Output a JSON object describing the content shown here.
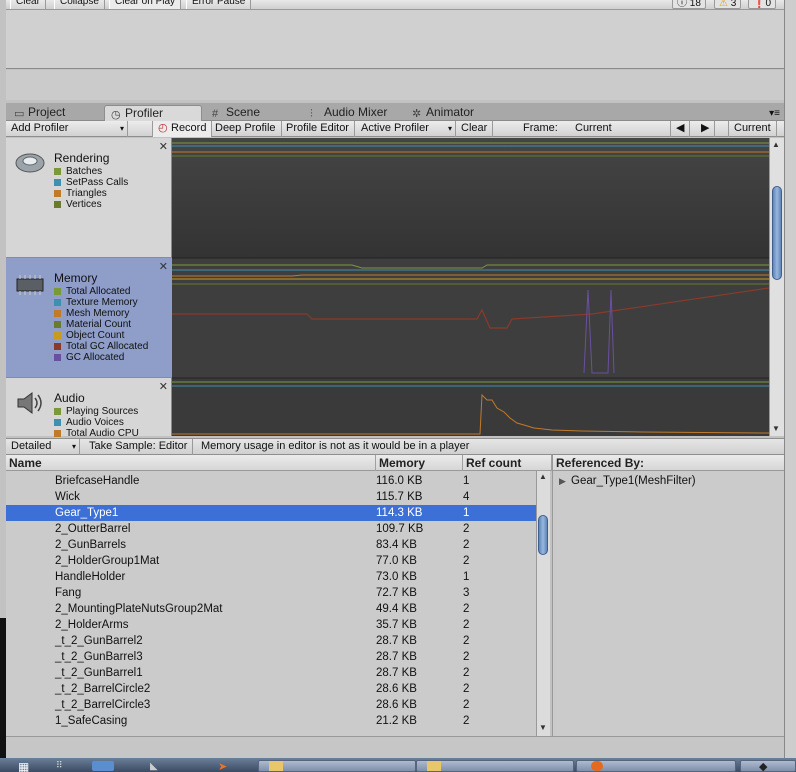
{
  "console": {
    "buttons": [
      "Clear",
      "Collapse",
      "Clear on Play",
      "Error Pause"
    ],
    "counts": {
      "info": "18",
      "warnings": "3",
      "errors": "0"
    }
  },
  "tabs": [
    {
      "label": "Project",
      "icon": "folder-icon"
    },
    {
      "label": "Profiler",
      "icon": "profiler-icon"
    },
    {
      "label": "Scene",
      "icon": "grid-icon"
    },
    {
      "label": "Audio Mixer",
      "icon": "mixer-icon"
    },
    {
      "label": "Animator",
      "icon": "animator-icon"
    }
  ],
  "toolbar": {
    "add_profiler": "Add Profiler",
    "record": "Record",
    "deep_profile": "Deep Profile",
    "profile_editor": "Profile Editor",
    "active_profiler": "Active Profiler",
    "clear": "Clear",
    "frame_label": "Frame:",
    "frame_value": "Current",
    "current_btn": "Current"
  },
  "modules": [
    {
      "title": "Rendering",
      "legend": [
        {
          "label": "Batches",
          "color": "#7a9a3a"
        },
        {
          "label": "SetPass Calls",
          "color": "#3f8fb0"
        },
        {
          "label": "Triangles",
          "color": "#c07a2a"
        },
        {
          "label": "Vertices",
          "color": "#6a7a30"
        }
      ]
    },
    {
      "title": "Memory",
      "legend": [
        {
          "label": "Total Allocated",
          "color": "#7a9a3a"
        },
        {
          "label": "Texture Memory",
          "color": "#3f8fb0"
        },
        {
          "label": "Mesh Memory",
          "color": "#c07a2a"
        },
        {
          "label": "Material Count",
          "color": "#6a7a30"
        },
        {
          "label": "Object Count",
          "color": "#c99a20"
        },
        {
          "label": "Total GC Allocated",
          "color": "#8a3a2a"
        },
        {
          "label": "GC Allocated",
          "color": "#6a50a0"
        }
      ]
    },
    {
      "title": "Audio",
      "legend": [
        {
          "label": "Playing Sources",
          "color": "#7a9a3a"
        },
        {
          "label": "Audio Voices",
          "color": "#3f8fb0"
        },
        {
          "label": "Total Audio CPU",
          "color": "#c07a2a"
        }
      ]
    }
  ],
  "detail_toolbar": {
    "mode": "Detailed",
    "take_sample": "Take Sample: Editor",
    "note": "Memory usage in editor is not as it would be in a player"
  },
  "table": {
    "columns": [
      "Name",
      "Memory",
      "Ref count"
    ],
    "rows": [
      {
        "name": "BriefcaseHandle",
        "memory": "116.0 KB",
        "refs": "1"
      },
      {
        "name": "Wick",
        "memory": "115.7 KB",
        "refs": "4"
      },
      {
        "name": "Gear_Type1",
        "memory": "114.3 KB",
        "refs": "1"
      },
      {
        "name": "2_OutterBarrel",
        "memory": "109.7 KB",
        "refs": "2"
      },
      {
        "name": "2_GunBarrels",
        "memory": "83.4 KB",
        "refs": "2"
      },
      {
        "name": "2_HolderGroup1Mat",
        "memory": "77.0 KB",
        "refs": "2"
      },
      {
        "name": "HandleHolder",
        "memory": "73.0 KB",
        "refs": "1"
      },
      {
        "name": "Fang",
        "memory": "72.7 KB",
        "refs": "3"
      },
      {
        "name": "2_MountingPlateNutsGroup2Mat",
        "memory": "49.4 KB",
        "refs": "2"
      },
      {
        "name": "2_HolderArms",
        "memory": "35.7 KB",
        "refs": "2"
      },
      {
        "name": "_t_2_GunBarrel2",
        "memory": "28.7 KB",
        "refs": "2"
      },
      {
        "name": "_t_2_GunBarrel3",
        "memory": "28.7 KB",
        "refs": "2"
      },
      {
        "name": "_t_2_GunBarrel1",
        "memory": "28.7 KB",
        "refs": "2"
      },
      {
        "name": "_t_2_BarrelCircle2",
        "memory": "28.6 KB",
        "refs": "2"
      },
      {
        "name": "_t_2_BarrelCircle3",
        "memory": "28.6 KB",
        "refs": "2"
      },
      {
        "name": "1_SafeCasing",
        "memory": "21.2 KB",
        "refs": "2"
      }
    ]
  },
  "referenced_by": {
    "header": "Referenced By:",
    "items": [
      "Gear_Type1(MeshFilter)"
    ]
  }
}
